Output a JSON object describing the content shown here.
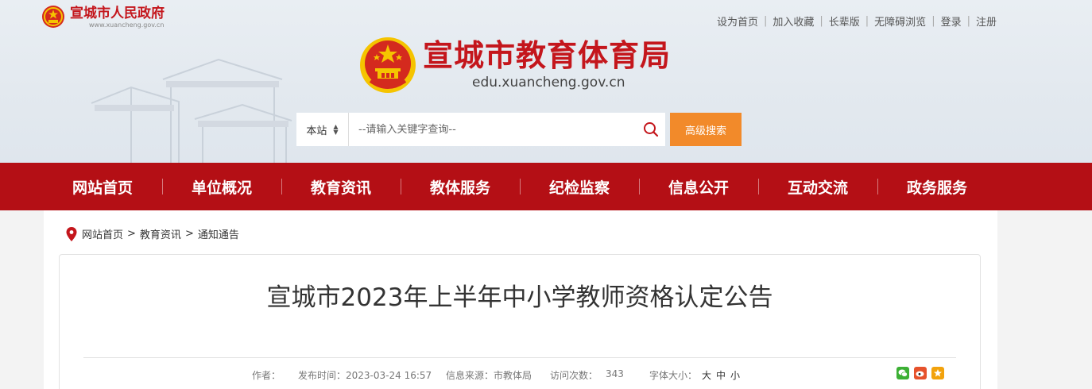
{
  "gov_site": {
    "name": "宣城市人民政府",
    "url": "www.xuancheng.gov.cn"
  },
  "top_links": [
    "设为首页",
    "加入收藏",
    "长辈版",
    "无障碍浏览",
    "登录",
    "注册"
  ],
  "brand": {
    "title": "宣城市教育体育局",
    "domain": "edu.xuancheng.gov.cn"
  },
  "search": {
    "scope": "本站",
    "placeholder": "--请输入关键字查询--",
    "advanced": "高级搜索"
  },
  "nav": [
    "网站首页",
    "单位概况",
    "教育资讯",
    "教体服务",
    "纪检监察",
    "信息公开",
    "互动交流",
    "政务服务"
  ],
  "breadcrumb": [
    "网站首页",
    "教育资讯",
    "通知通告"
  ],
  "article": {
    "title": "宣城市2023年上半年中小学教师资格认定公告",
    "author_label": "作者：",
    "author": "",
    "date_label": "发布时间：",
    "date": "2023-03-24 16:57",
    "source_label": "信息来源：",
    "source": "市教体局",
    "visits_label": "访问次数：",
    "visits": "343",
    "font_label": "字体大小：",
    "font_sizes": [
      "大",
      "中",
      "小"
    ]
  },
  "colors": {
    "brand_red": "#c4161c",
    "nav_red": "#b40f15",
    "accent_orange": "#f28a2a"
  },
  "share_icons": [
    "wechat-icon",
    "weibo-icon",
    "favorite-icon"
  ]
}
